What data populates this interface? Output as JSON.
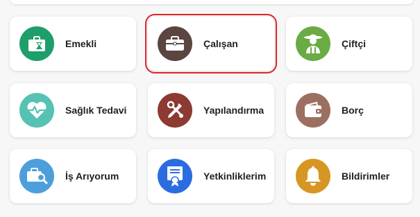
{
  "grid": {
    "cards": [
      {
        "label": "Emekli",
        "icon": "retiree-briefcase-hourglass-icon",
        "color": "#1e9e6a"
      },
      {
        "label": "Çalışan",
        "icon": "briefcase-icon",
        "color": "#5a4540",
        "selected": true
      },
      {
        "label": "Çiftçi",
        "icon": "farmer-icon",
        "color": "#6aab45"
      },
      {
        "label": "Sağlık Tedavi",
        "icon": "heart-pulse-icon",
        "color": "#56c2b3"
      },
      {
        "label": "Yapılandırma",
        "icon": "pencil-wrench-icon",
        "color": "#8c3a32"
      },
      {
        "label": "Borç",
        "icon": "wallet-icon",
        "color": "#9c7060"
      },
      {
        "label": "İş Arıyorum",
        "icon": "job-search-icon",
        "color": "#4d9fdc"
      },
      {
        "label": "Yetkinliklerim",
        "icon": "certificate-icon",
        "color": "#2b6de0"
      },
      {
        "label": "Bildirimler",
        "icon": "bell-icon",
        "color": "#d79624"
      }
    ]
  }
}
